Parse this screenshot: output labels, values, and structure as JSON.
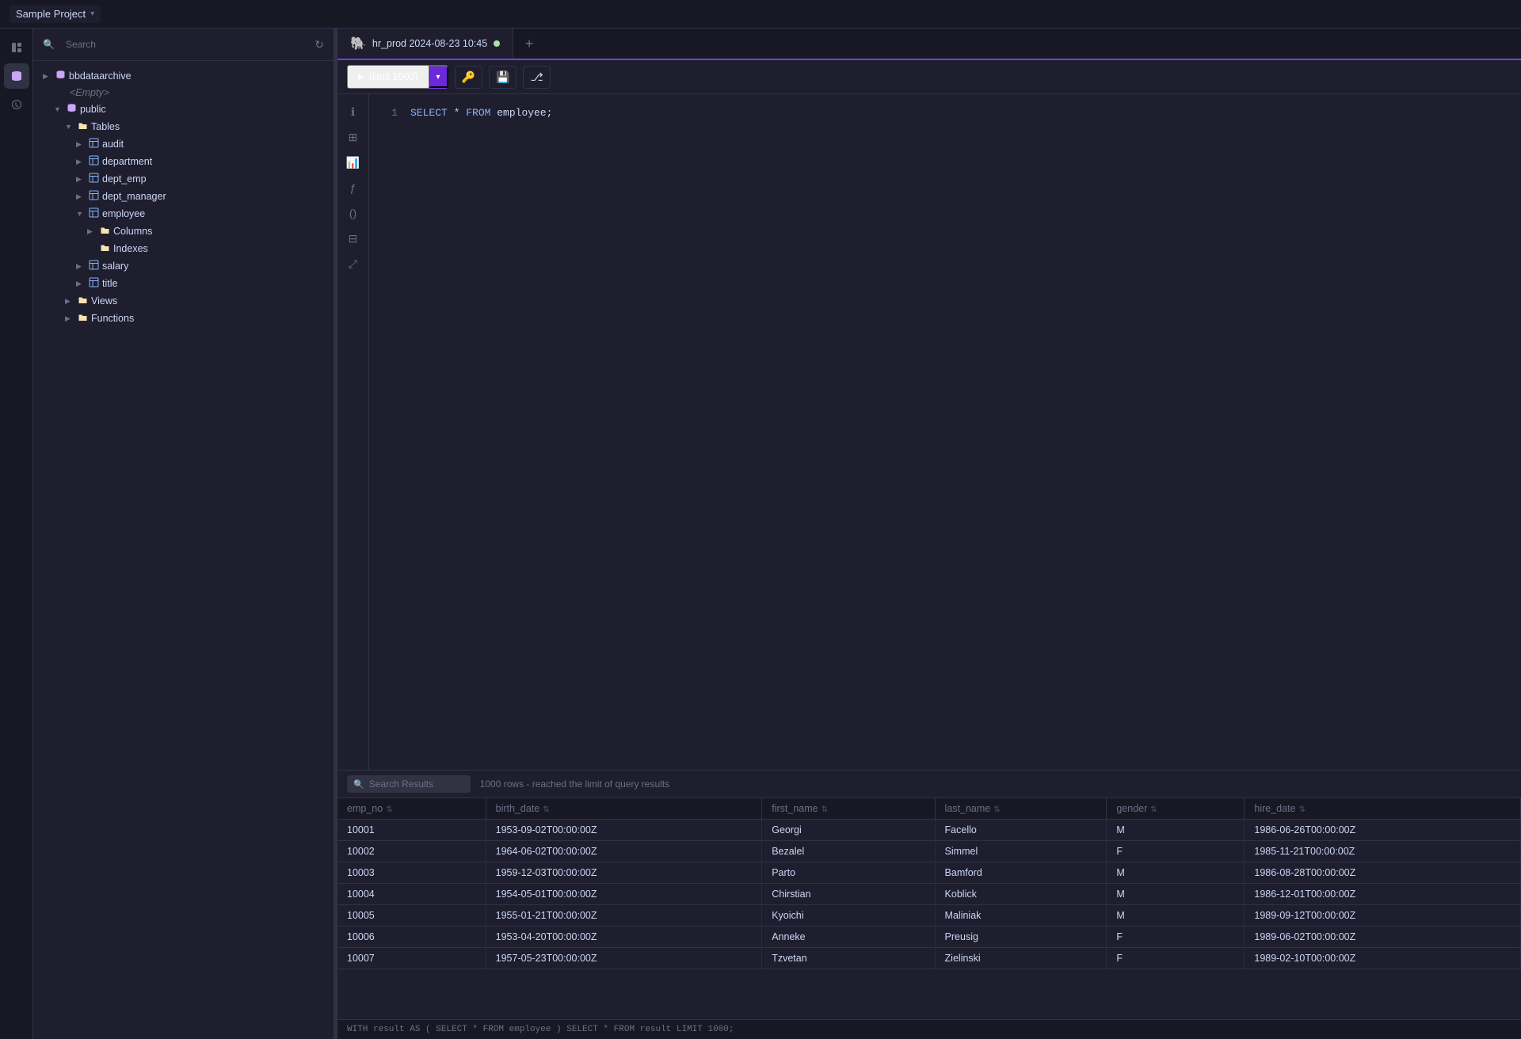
{
  "topbar": {
    "project_name": "Sample Project"
  },
  "sidebar": {
    "search_placeholder": "Search",
    "tree": [
      {
        "id": "bbdataarchive",
        "level": 0,
        "arrow": "▶",
        "icon": "🗄",
        "label": "bbdataarchive",
        "type": "db"
      },
      {
        "id": "empty",
        "level": 1,
        "arrow": "",
        "icon": "",
        "label": "<Empty>",
        "type": "empty"
      },
      {
        "id": "public",
        "level": 1,
        "arrow": "▼",
        "icon": "🗄",
        "label": "public",
        "type": "schema"
      },
      {
        "id": "tables",
        "level": 2,
        "arrow": "▼",
        "icon": "📁",
        "label": "Tables",
        "type": "folder"
      },
      {
        "id": "audit",
        "level": 3,
        "arrow": "▶",
        "icon": "⊞",
        "label": "audit",
        "type": "table"
      },
      {
        "id": "department",
        "level": 3,
        "arrow": "▶",
        "icon": "⊞",
        "label": "department",
        "type": "table"
      },
      {
        "id": "dept_emp",
        "level": 3,
        "arrow": "▶",
        "icon": "⊞",
        "label": "dept_emp",
        "type": "table"
      },
      {
        "id": "dept_manager",
        "level": 3,
        "arrow": "▶",
        "icon": "⊞",
        "label": "dept_manager",
        "type": "table"
      },
      {
        "id": "employee",
        "level": 3,
        "arrow": "▼",
        "icon": "⊞",
        "label": "employee",
        "type": "table"
      },
      {
        "id": "columns",
        "level": 4,
        "arrow": "▶",
        "icon": "📁",
        "label": "Columns",
        "type": "folder"
      },
      {
        "id": "indexes",
        "level": 4,
        "arrow": "",
        "icon": "📁",
        "label": "Indexes",
        "type": "folder"
      },
      {
        "id": "salary",
        "level": 3,
        "arrow": "▶",
        "icon": "⊞",
        "label": "salary",
        "type": "table"
      },
      {
        "id": "title",
        "level": 3,
        "arrow": "▶",
        "icon": "⊞",
        "label": "title",
        "type": "table"
      },
      {
        "id": "views",
        "level": 2,
        "arrow": "▶",
        "icon": "📁",
        "label": "Views",
        "type": "folder"
      },
      {
        "id": "functions",
        "level": 2,
        "arrow": "▶",
        "icon": "📁",
        "label": "Functions",
        "type": "folder"
      }
    ]
  },
  "editor": {
    "tab_title": "hr_prod 2024-08-23 10:45",
    "tab_dot_color": "#a6e3a1",
    "run_label": "(limit 1000)",
    "sql_lines": [
      {
        "num": "1",
        "content": "SELECT * FROM employee;"
      }
    ]
  },
  "results": {
    "search_placeholder": "Search Results",
    "info": "1000 rows  -  reached the limit of query results",
    "columns": [
      "emp_no",
      "birth_date",
      "first_name",
      "last_name",
      "gender",
      "hire_date"
    ],
    "rows": [
      {
        "emp_no": "10001",
        "birth_date": "1953-09-02T00:00:00Z",
        "first_name": "Georgi",
        "last_name": "Facello",
        "gender": "M",
        "hire_date": "1986-06-26T00:00:00Z"
      },
      {
        "emp_no": "10002",
        "birth_date": "1964-06-02T00:00:00Z",
        "first_name": "Bezalel",
        "last_name": "Simmel",
        "gender": "F",
        "hire_date": "1985-11-21T00:00:00Z"
      },
      {
        "emp_no": "10003",
        "birth_date": "1959-12-03T00:00:00Z",
        "first_name": "Parto",
        "last_name": "Bamford",
        "gender": "M",
        "hire_date": "1986-08-28T00:00:00Z"
      },
      {
        "emp_no": "10004",
        "birth_date": "1954-05-01T00:00:00Z",
        "first_name": "Chirstian",
        "last_name": "Koblick",
        "gender": "M",
        "hire_date": "1986-12-01T00:00:00Z"
      },
      {
        "emp_no": "10005",
        "birth_date": "1955-01-21T00:00:00Z",
        "first_name": "Kyoichi",
        "last_name": "Maliniak",
        "gender": "M",
        "hire_date": "1989-09-12T00:00:00Z"
      },
      {
        "emp_no": "10006",
        "birth_date": "1953-04-20T00:00:00Z",
        "first_name": "Anneke",
        "last_name": "Preusig",
        "gender": "F",
        "hire_date": "1989-06-02T00:00:00Z"
      },
      {
        "emp_no": "10007",
        "birth_date": "1957-05-23T00:00:00Z",
        "first_name": "Tzvetan",
        "last_name": "Zielinski",
        "gender": "F",
        "hire_date": "1989-02-10T00:00:00Z"
      }
    ],
    "footer": "WITH result AS ( SELECT * FROM employee ) SELECT * FROM result LIMIT 1000;"
  },
  "icons": {
    "db_icon": "🐘",
    "search_icon": "🔍",
    "refresh_icon": "↻",
    "play_icon": "▶",
    "key_icon": "🔑",
    "save_icon": "💾",
    "share_icon": "⎇",
    "info_icon": "ℹ",
    "grid_icon": "⊞",
    "chart_icon": "📊",
    "func_icon": "ƒ",
    "paren_icon": "()",
    "table_icon": "⊟",
    "expand_icon": "⤢",
    "history_icon": "🕐",
    "sidebar_icon": "☰"
  }
}
